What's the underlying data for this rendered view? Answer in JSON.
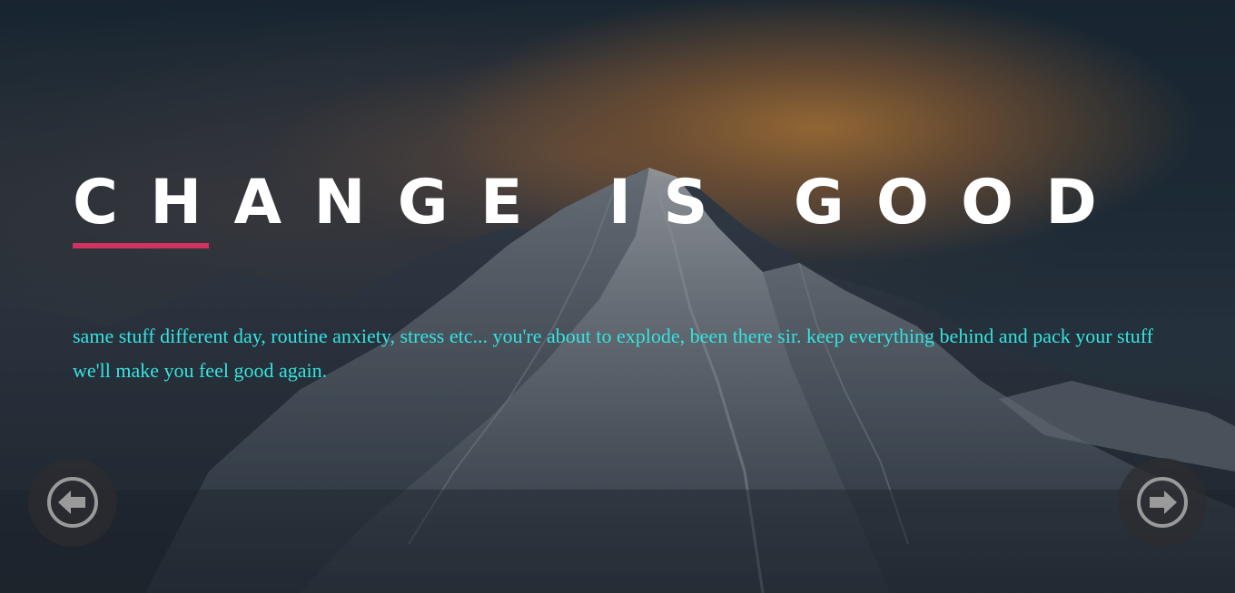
{
  "hero": {
    "title": "CHANGE IS GOOD",
    "tagline": "same stuff different day, routine anxiety, stress etc... you're about to explode, been there sir. keep everything behind and pack your stuff we'll make you feel good again."
  },
  "navigation": {
    "prev_icon": "arrow-left-circle-icon",
    "next_icon": "arrow-right-circle-icon"
  },
  "colors": {
    "title": "#ffffff",
    "accent_underline": "#d1325f",
    "tagline": "#36e3de",
    "nav_button_bg": "#2d2d30",
    "nav_icon": "#9a9a9a"
  }
}
